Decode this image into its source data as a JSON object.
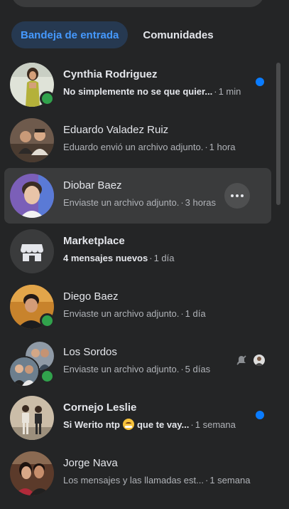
{
  "tabs": [
    {
      "label": "Bandeja de entrada",
      "active": true
    },
    {
      "label": "Comunidades",
      "active": false
    }
  ],
  "conversations": [
    {
      "name": "Cynthia Rodriguez",
      "preview": "No simplemente no se que quier...",
      "time": "1 min",
      "unread": true,
      "online": true
    },
    {
      "name": "Eduardo Valadez Ruiz",
      "preview": "Eduardo envió un archivo adjunto.",
      "time": "1 hora",
      "unread": false,
      "online": false
    },
    {
      "name": "Diobar Baez",
      "preview": "Enviaste un archivo adjunto.",
      "time": "3 horas",
      "unread": false,
      "online": false,
      "hovered": true
    },
    {
      "name": "Marketplace",
      "preview": "4 mensajes nuevos",
      "time": "1 día",
      "unread": true,
      "icon": "store-icon"
    },
    {
      "name": "Diego Baez",
      "preview": "Enviaste un archivo adjunto.",
      "time": "1 día",
      "unread": false,
      "online": true
    },
    {
      "name": "Los Sordos",
      "preview": "Enviaste un archivo adjunto.",
      "time": "5 días",
      "unread": false,
      "online": true,
      "muted": true
    },
    {
      "name": "Cornejo Leslie",
      "preview_before": "Si Werito ntp",
      "preview_after": "que te vay...",
      "time": "1 semana",
      "unread": true,
      "emoji": "grinning-face-icon"
    },
    {
      "name": "Jorge Nava",
      "preview": "Los mensajes y las llamadas est...",
      "time": "1 semana",
      "unread": false
    }
  ],
  "colors": {
    "background": "#242526",
    "accent": "#0a7cff",
    "active_tab_bg": "#263951",
    "active_tab_text": "#4599ff",
    "online": "#31a24c"
  }
}
